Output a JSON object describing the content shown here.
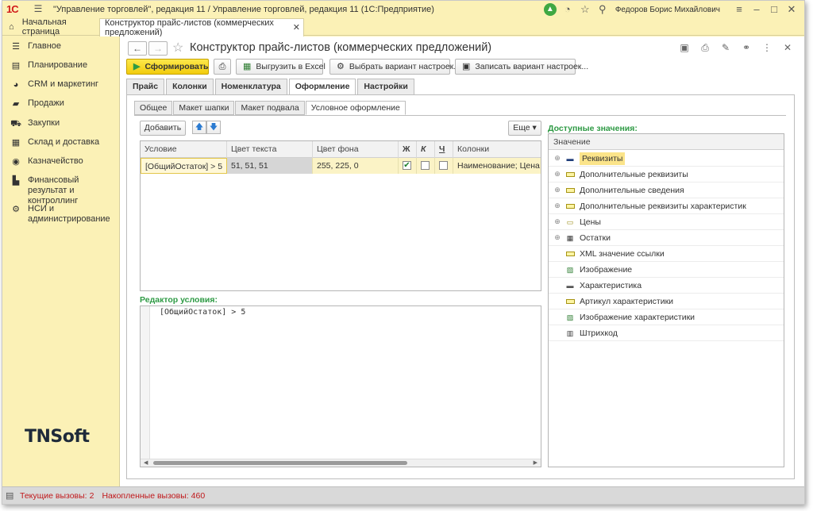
{
  "window": {
    "logo": "1С",
    "title": "\"Управление торговлей\", редакция 11 / Управление торговлей, редакция 11  (1С:Предприятие)",
    "user": "Федоров Борис Михайлович"
  },
  "tabs": {
    "home": "Начальная страница",
    "active": "Конструктор прайс-листов (коммерческих предложений)"
  },
  "sidebar": {
    "items": [
      {
        "label": "Главное",
        "icon": "menu-icon"
      },
      {
        "label": "Планирование",
        "icon": "planning-icon"
      },
      {
        "label": "CRM и маркетинг",
        "icon": "crm-icon"
      },
      {
        "label": "Продажи",
        "icon": "sales-icon"
      },
      {
        "label": "Закупки",
        "icon": "cart-icon"
      },
      {
        "label": "Склад и доставка",
        "icon": "warehouse-icon"
      },
      {
        "label": "Казначейство",
        "icon": "treasury-icon"
      },
      {
        "label": "Финансовый результат и контроллинг",
        "icon": "finance-icon"
      },
      {
        "label": "НСИ и администрирование",
        "icon": "gear-icon"
      }
    ]
  },
  "brand": {
    "part1": "TN",
    "part2": "Soft"
  },
  "page": {
    "title": "Конструктор прайс-листов (коммерческих предложений)"
  },
  "toolbar": {
    "generate": "Сформировать",
    "export_excel": "Выгрузить в Excel",
    "choose_variant": "Выбрать вариант настроек...",
    "save_variant": "Записать вариант настроек..."
  },
  "main_tabs": [
    "Прайс",
    "Колонки",
    "Номенклатура",
    "Оформление",
    "Настройки"
  ],
  "main_tab_active": "Оформление",
  "sub_tabs": [
    "Общее",
    "Макет шапки",
    "Макет подвала",
    "Условное оформление"
  ],
  "sub_tab_active": "Условное оформление",
  "grid": {
    "add": "Добавить",
    "more": "Еще",
    "columns": [
      "Условие",
      "Цвет текста",
      "Цвет фона",
      "Ж",
      "К",
      "Ч",
      "Колонки"
    ],
    "rows": [
      {
        "condition": "[ОбщийОстаток] > 5",
        "text_color": "51, 51, 51",
        "bg_color": "255, 225, 0",
        "bold": true,
        "italic": false,
        "underline": false,
        "columns": "Наименование; Цена"
      }
    ]
  },
  "editor": {
    "label": "Редактор условия:",
    "text": "[ОбщийОстаток] > 5"
  },
  "available": {
    "label": "Доступные значения:",
    "header": "Значение",
    "items": [
      {
        "label": "Реквизиты",
        "expandable": true,
        "icon": "dash-icon"
      },
      {
        "label": "Дополнительные реквизиты",
        "expandable": true,
        "icon": "field-icon"
      },
      {
        "label": "Дополнительные сведения",
        "expandable": true,
        "icon": "field-icon"
      },
      {
        "label": "Дополнительные реквизиты характеристик",
        "expandable": true,
        "icon": "field-icon"
      },
      {
        "label": "Цены",
        "expandable": true,
        "icon": "price-icon"
      },
      {
        "label": "Остатки",
        "expandable": true,
        "icon": "table-icon"
      },
      {
        "label": "XML значение ссылки",
        "expandable": false,
        "icon": "field-icon"
      },
      {
        "label": "Изображение",
        "expandable": false,
        "icon": "image-icon"
      },
      {
        "label": "Характеристика",
        "expandable": false,
        "icon": "characteristic-icon"
      },
      {
        "label": "Артикул характеристики",
        "expandable": false,
        "icon": "field-icon"
      },
      {
        "label": "Изображение характеристики",
        "expandable": false,
        "icon": "image-icon"
      },
      {
        "label": "Штрихкод",
        "expandable": false,
        "icon": "barcode-icon"
      }
    ]
  },
  "status": {
    "current_label": "Текущие вызовы:",
    "current_value": "2",
    "accum_label": "Накопленные вызовы:",
    "accum_value": "460"
  },
  "colors": {
    "panel": "#fbf1b6",
    "accent_green": "#2e9a44",
    "primary_button": "#f2cc0c",
    "selected_row": "#fbf3c6",
    "status_red": "#c0181b"
  }
}
